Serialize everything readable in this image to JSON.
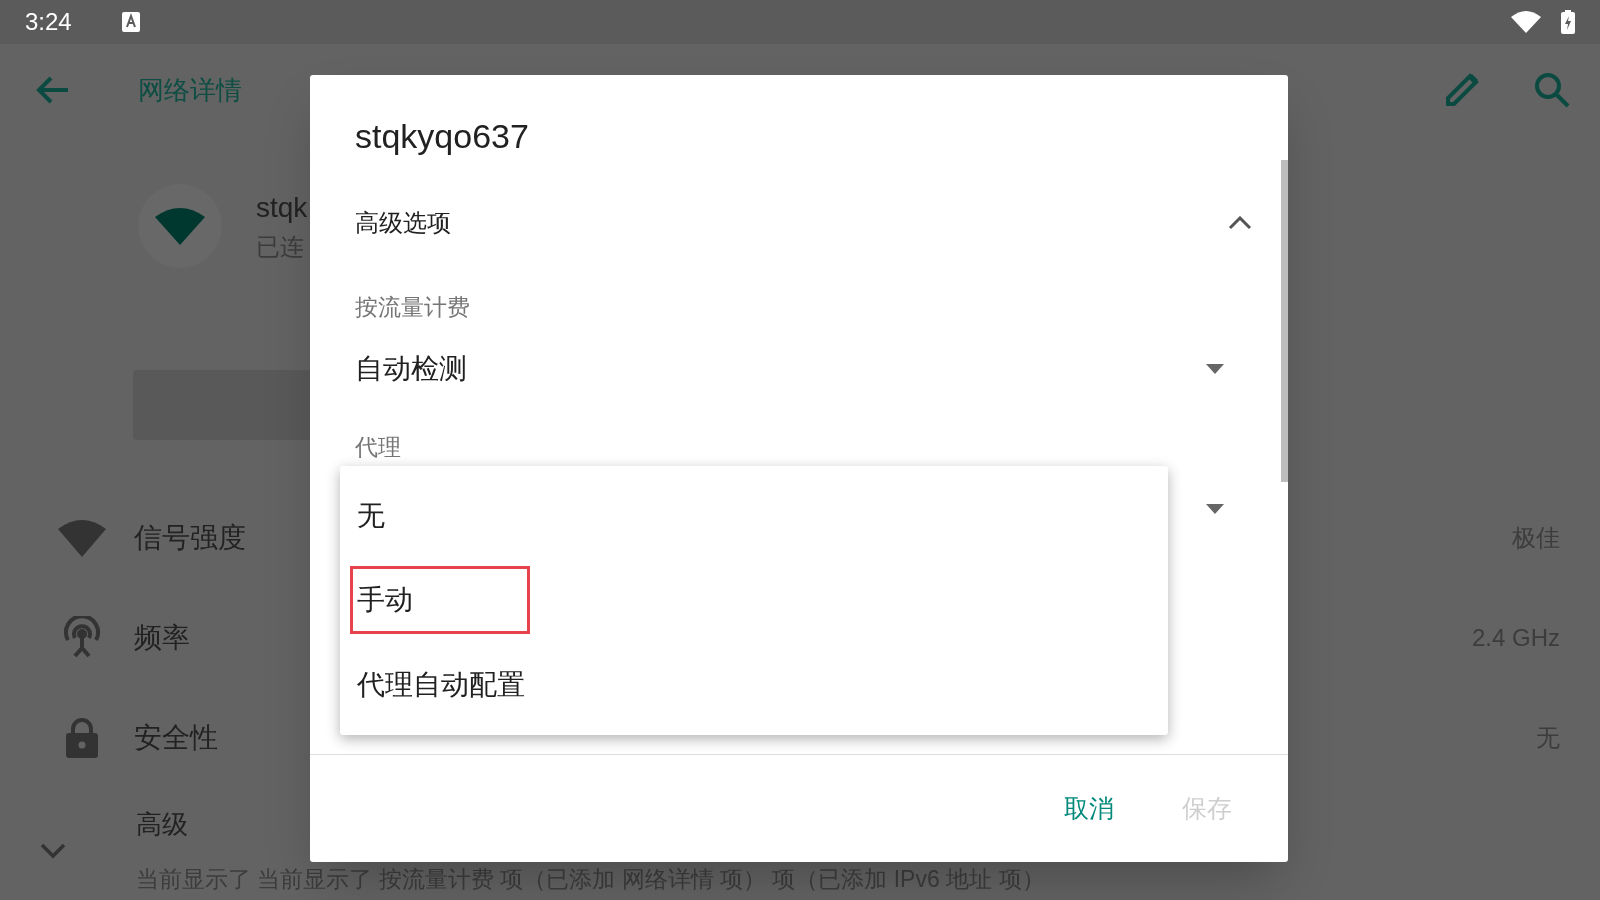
{
  "status_bar": {
    "time": "3:24"
  },
  "app_bar": {
    "title": "网络详情"
  },
  "network": {
    "name": "stqk",
    "status": "已连"
  },
  "details": [
    {
      "kind": "signal",
      "label": "信号强度",
      "value": "极佳"
    },
    {
      "kind": "frequency",
      "label": "频率",
      "value": "2.4 GHz"
    },
    {
      "kind": "security",
      "label": "安全性",
      "value": "无"
    }
  ],
  "advanced": {
    "label": "高级",
    "summary": "当前显示了 当前显示了 按流量计费 项（已添加 网络详情 项） 项（已添加 IPv6 地址 项）",
    "expanded": false
  },
  "dialog": {
    "title": "stqkyqo637",
    "section": {
      "label": "高级选项",
      "expanded": true
    },
    "fields": [
      {
        "label": "按流量计费",
        "value": "自动检测"
      },
      {
        "label": "代理"
      }
    ],
    "buttons": [
      {
        "label": "取消",
        "disabled": false
      },
      {
        "label": "保存",
        "disabled": true
      }
    ]
  },
  "menu": {
    "items": [
      {
        "label": "无",
        "highlighted": false
      },
      {
        "label": "手动",
        "highlighted": true
      },
      {
        "label": "代理自动配置",
        "highlighted": false
      }
    ]
  }
}
